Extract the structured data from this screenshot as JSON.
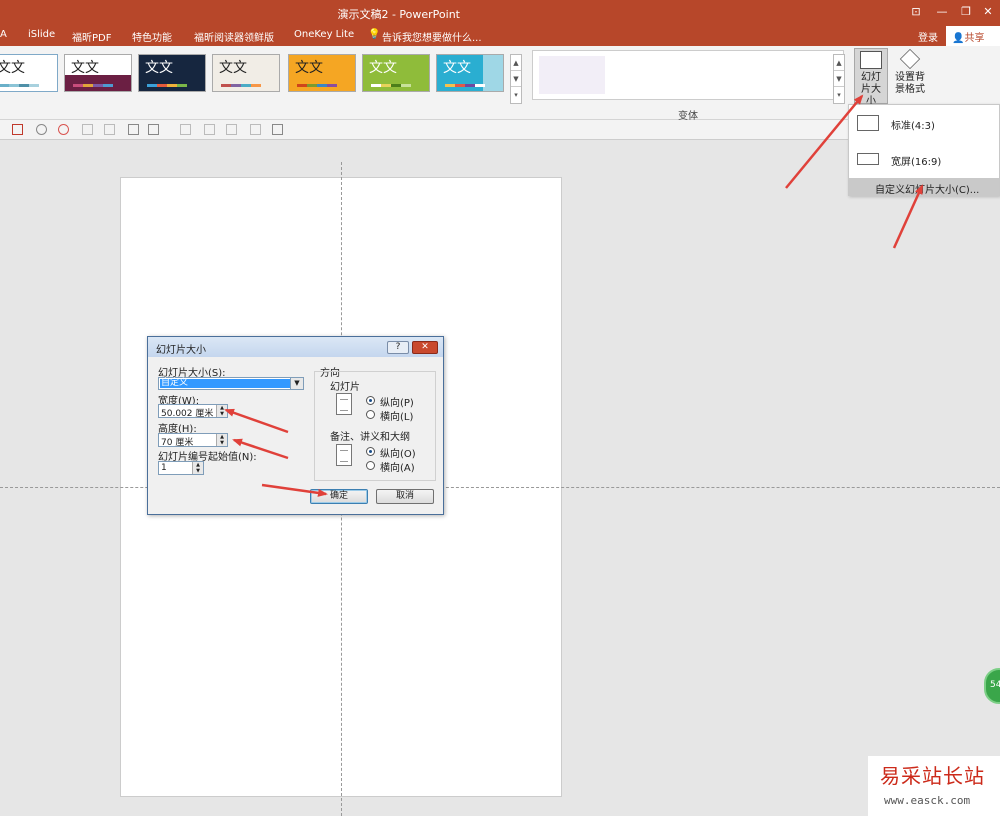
{
  "window": {
    "title": "演示文稿2 - PowerPoint",
    "ribbon_toggle_icon": "ribbon-display-icon",
    "minimize": "—",
    "restore": "❐",
    "close": "✕"
  },
  "menu": {
    "items": [
      "A",
      "iSlide",
      "福昕PDF",
      "特色功能",
      "福昕阅读器领鲜版",
      "OneKey Lite"
    ],
    "tell_me": "告诉我您想要做什么...",
    "login": "登录",
    "share": "共享"
  },
  "ribbon": {
    "theme_glyph": "文文",
    "variant_group_label": "变体",
    "slide_size_button": "幻灯片大小",
    "format_background_button": "设置背景格式",
    "scroll_up": "▲",
    "scroll_down": "▼",
    "scroll_more": "▾"
  },
  "slide_size_menu": {
    "standard": "标准(4:3)",
    "widescreen": "宽屏(16:9)",
    "custom": "自定义幻灯片大小(C)..."
  },
  "dialog": {
    "title": "幻灯片大小",
    "help": "?",
    "close": "✕",
    "size_for_label": "幻灯片大小(S):",
    "size_for_value": "自定义",
    "width_label": "宽度(W):",
    "width_value": "50.002 厘米",
    "height_label": "高度(H):",
    "height_value": "70 厘米",
    "number_from_label": "幻灯片编号起始值(N):",
    "number_from_value": "1",
    "orientation_label": "方向",
    "slides_label": "幻灯片",
    "portrait": "纵向(P)",
    "landscape": "横向(L)",
    "notes_label": "备注、讲义和大纲",
    "notes_portrait": "纵向(O)",
    "notes_landscape": "横向(A)",
    "ok": "确定",
    "cancel": "取消"
  },
  "badge": {
    "text": "54"
  },
  "watermark": {
    "title": "易采站长站",
    "url": "www.easck.com"
  },
  "colors": {
    "accent": "#b7472a",
    "annotation_arrow": "#e0413a"
  }
}
